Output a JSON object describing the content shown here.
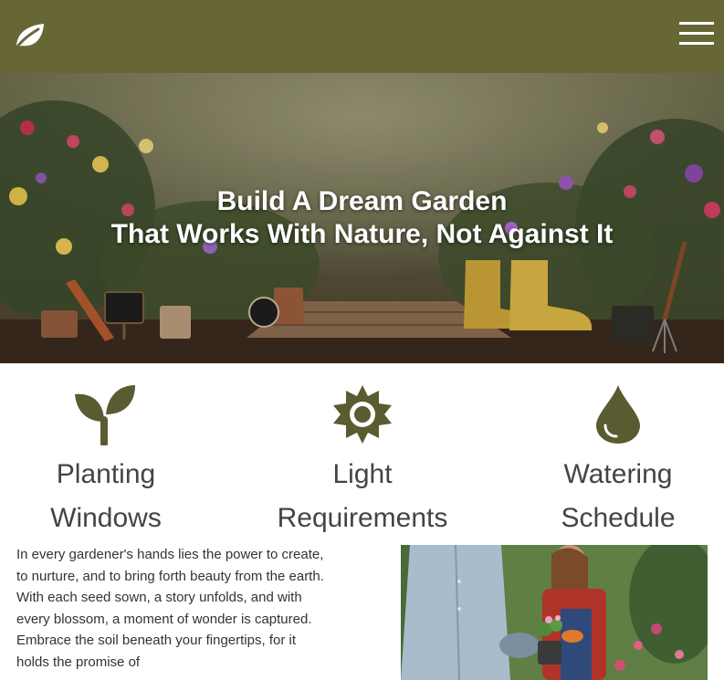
{
  "header": {
    "logo_icon": "leaf-icon",
    "menu_icon": "hamburger-menu-icon",
    "background_color": "#676736"
  },
  "hero": {
    "title_line1": "Build A Dream Garden",
    "title_line2": "That Works With Nature, Not Against It"
  },
  "features": [
    {
      "icon": "sprout-icon",
      "label_line1": "Planting",
      "label_line2": "Windows"
    },
    {
      "icon": "sun-icon",
      "label_line1": "Light",
      "label_line2": "Requirements"
    },
    {
      "icon": "water-drop-icon",
      "label_line1": "Watering",
      "label_line2": "Schedule"
    }
  ],
  "icon_color": "#5b5b32",
  "intro": {
    "text": "In every gardener's hands lies the power to create, to nurture, and to bring forth beauty from the earth. With each seed sown, a story unfolds, and with every blossom, a moment of wonder is captured. Embrace the soil beneath your fingertips, for it holds the promise of"
  }
}
